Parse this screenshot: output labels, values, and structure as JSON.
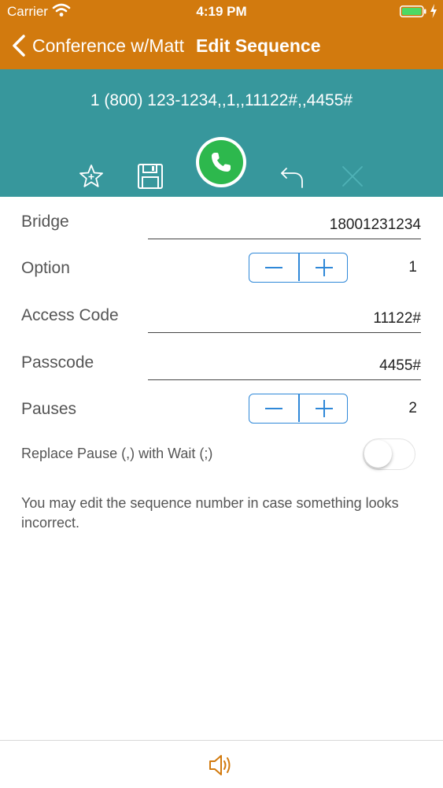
{
  "status_bar": {
    "carrier": "Carrier",
    "time": "4:19 PM",
    "wifi_icon": "wifi-icon",
    "battery_icon": "battery-icon",
    "charging_icon": "charging-bolt-icon"
  },
  "nav": {
    "back_label": "Conference w/Matt",
    "title": "Edit Sequence"
  },
  "header": {
    "sequence": "1 (800) 123-1234,,1,,11122#,,4455#",
    "toolbar_icons": [
      "star-icon",
      "save-icon",
      "phone-icon",
      "undo-icon",
      "close-icon"
    ]
  },
  "form": {
    "bridge": {
      "label": "Bridge",
      "value": "18001231234"
    },
    "option": {
      "label": "Option",
      "value": "1"
    },
    "access_code": {
      "label": "Access Code",
      "value": "11122#"
    },
    "passcode": {
      "label": "Passcode",
      "value": "4455#"
    },
    "pauses": {
      "label": "Pauses",
      "value": "2"
    },
    "replace_pause": {
      "label": "Replace Pause (,) with Wait (;)",
      "enabled": false
    }
  },
  "note": "You may edit the sequence number in case something looks incorrect.",
  "footer": {
    "speaker_icon": "speaker-icon"
  },
  "colors": {
    "nav_bar": "#d27a0e",
    "header_bg": "#37979c",
    "call_button": "#2db84d",
    "accent_blue": "#2f88d8"
  }
}
